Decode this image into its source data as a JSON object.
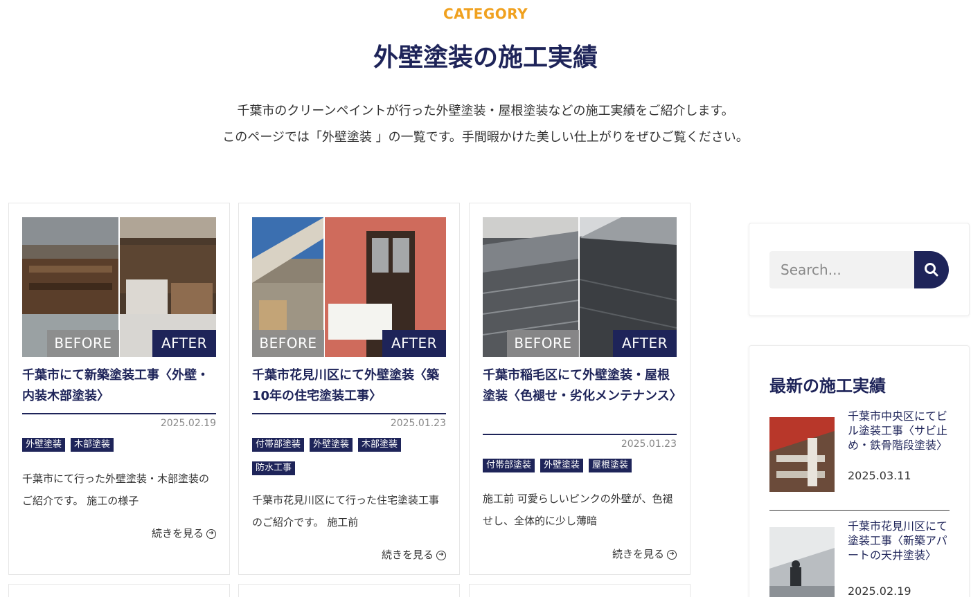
{
  "header": {
    "eyebrow": "CATEGORY",
    "title": "外壁塗装の施工実績",
    "intro_line1": "千葉市のクリーンペイントが行った外壁塗装・屋根塗装などの施工実績をご紹介します。",
    "intro_line2": "このページでは「外壁塗装 」の一覧です。手間暇かけた美しい仕上がりをぜひご覧ください。"
  },
  "labels": {
    "before": "BEFORE",
    "after": "AFTER",
    "read_more": "続きを見る"
  },
  "posts": [
    {
      "title": "千葉市にて新築塗装工事〈外壁・内装木部塗装〉",
      "date": "2025.02.19",
      "categories": [
        "外壁塗装",
        "木部塗装"
      ],
      "excerpt": "千葉市にて行った外壁塗装・木部塗装のご紹介です。 施工の様子"
    },
    {
      "title": "千葉市花見川区にて外壁塗装〈築10年の住宅塗装工事〉",
      "date": "2025.01.23",
      "categories": [
        "付帯部塗装",
        "外壁塗装",
        "木部塗装",
        "防水工事"
      ],
      "excerpt": "千葉市花見川区にて行った住宅塗装工事のご紹介です。 施工前"
    },
    {
      "title": "千葉市稲毛区にて外壁塗装・屋根塗装〈色褪せ・劣化メンテナンス〉",
      "date": "2025.01.23",
      "categories": [
        "付帯部塗装",
        "外壁塗装",
        "屋根塗装"
      ],
      "excerpt": "施工前 可愛らしいピンクの外壁が、色褪せし、全体的に少し薄暗"
    }
  ],
  "sidebar": {
    "search_placeholder": "Search...",
    "recent_title": "最新の施工実績",
    "recent": [
      {
        "title": "千葉市中央区にてビル塗装工事〈サビ止め・鉄骨階段塗装〉",
        "date": "2025.03.11"
      },
      {
        "title": "千葉市花見川区にて塗装工事〈新築アパートの天井塗装〉",
        "date": "2025.02.19"
      }
    ]
  },
  "colors": {
    "navy": "#1e2459",
    "accent": "#f0a11f"
  }
}
